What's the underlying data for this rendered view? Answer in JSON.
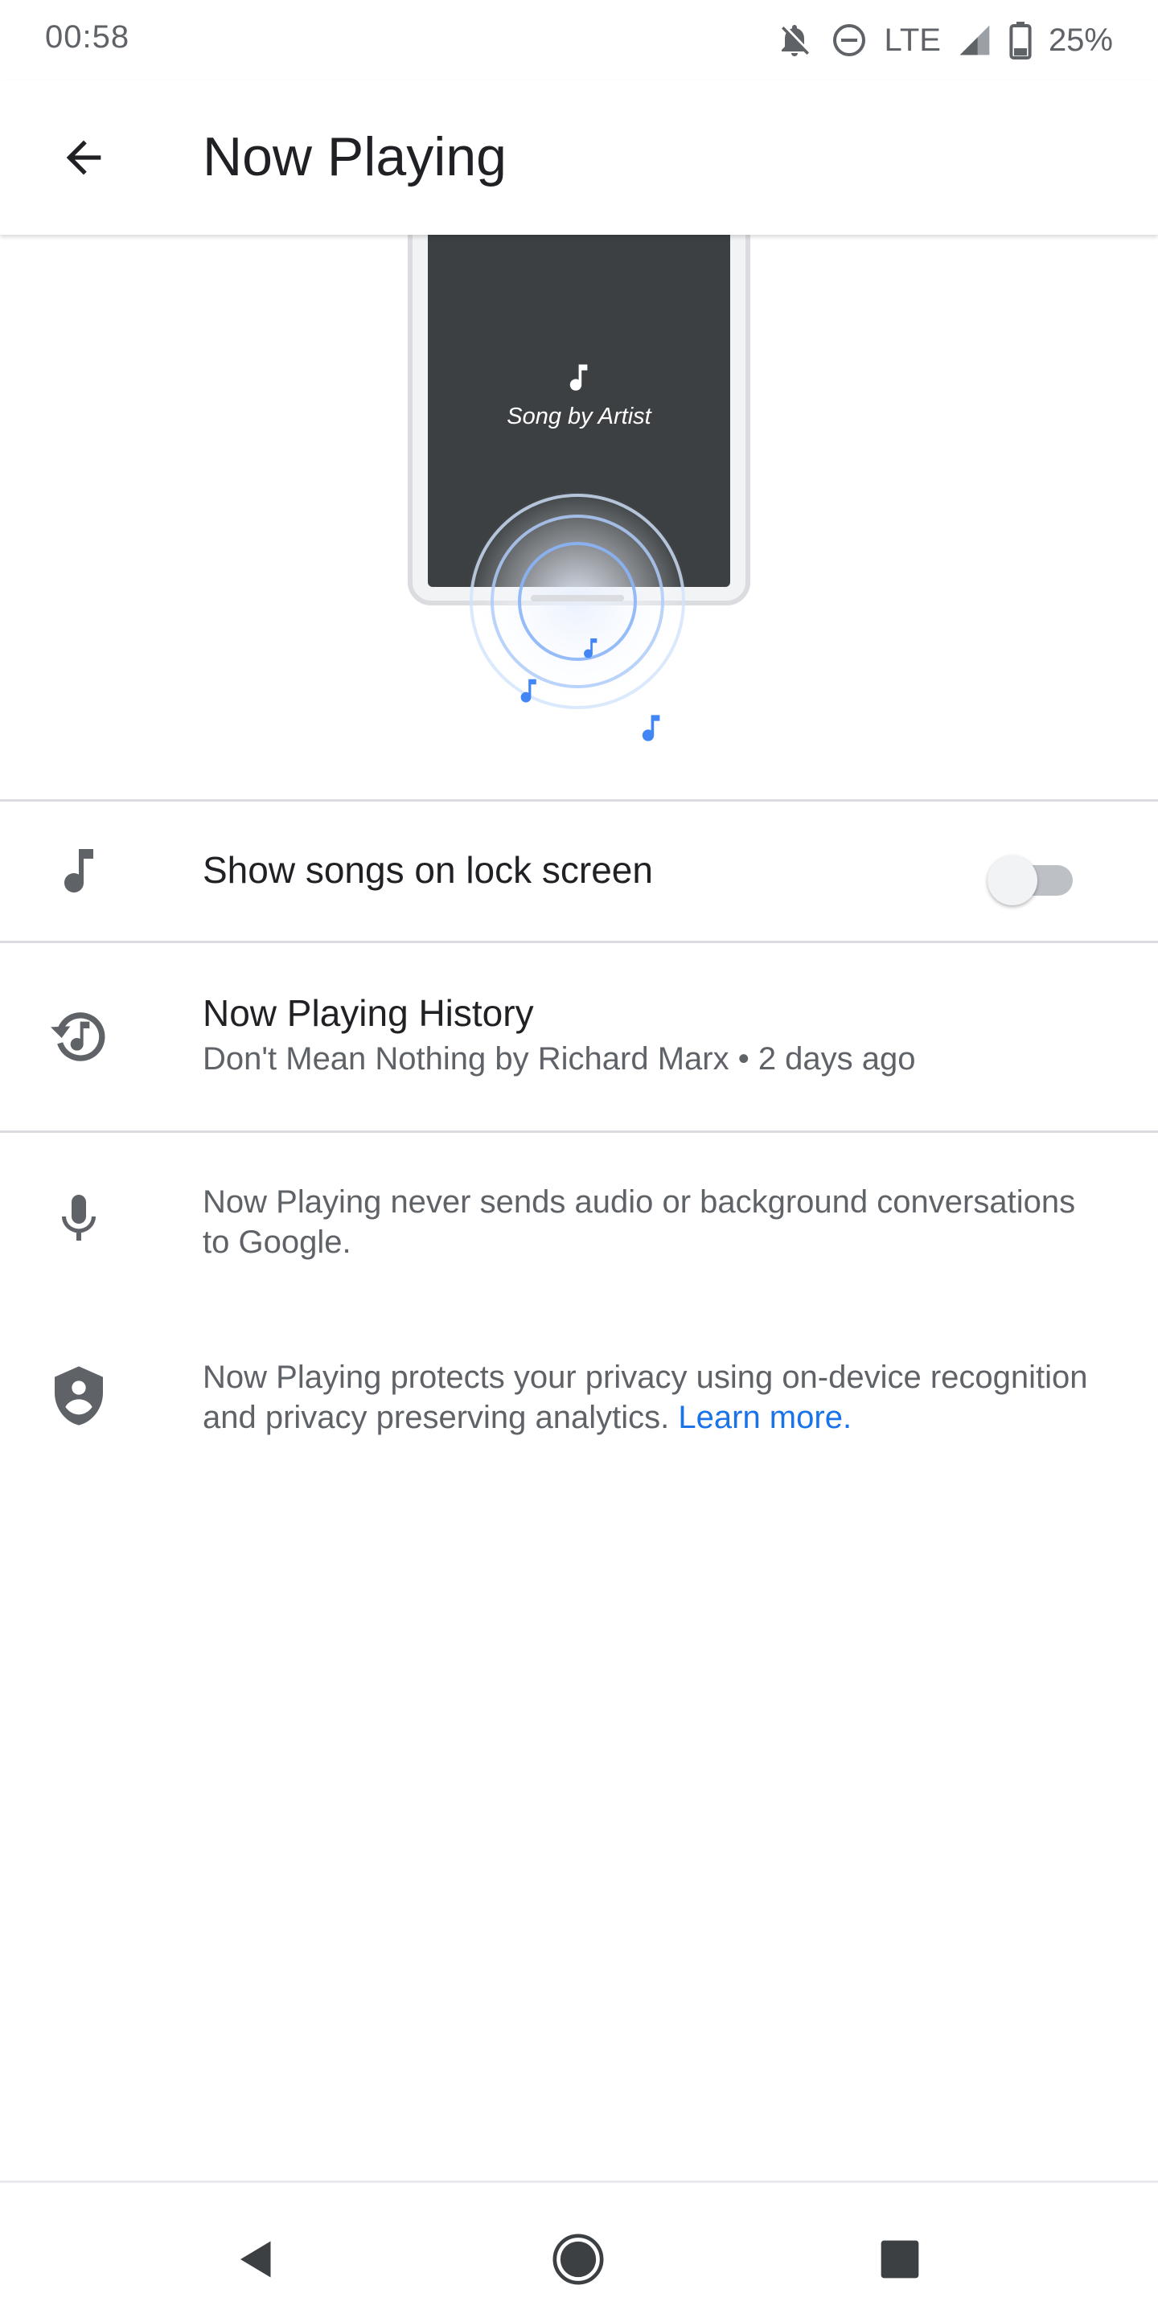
{
  "status_bar": {
    "time": "00:58",
    "network": "LTE",
    "battery": "25%",
    "icons": [
      "notifications-off-icon",
      "do-not-disturb-icon",
      "signal-icon",
      "battery-icon"
    ]
  },
  "app_bar": {
    "title": "Now Playing",
    "back_icon": "arrow-back-icon"
  },
  "illustration": {
    "song_caption": "Song by Artist",
    "phone_screen_color": "#3c4043",
    "ripple_color": "#4285f4"
  },
  "settings": {
    "lock_screen": {
      "icon": "music-note-icon",
      "label": "Show songs on lock screen",
      "toggle_on": false
    },
    "history": {
      "icon": "history-music-icon",
      "title": "Now Playing History",
      "subtitle": "Don't Mean Nothing by Richard Marx • 2 days ago"
    }
  },
  "info": {
    "audio_note": {
      "icon": "microphone-icon",
      "text": "Now Playing never sends audio or background conversations to Google."
    },
    "privacy_note": {
      "icon": "shield-person-icon",
      "text": "Now Playing protects your privacy using on-device recognition and privacy preserving analytics. ",
      "link": "Learn more."
    }
  },
  "nav_bar": {
    "buttons": [
      "back-triangle-icon",
      "home-circle-icon",
      "recents-square-icon"
    ]
  },
  "colors": {
    "accent": "#1a73e8",
    "secondary_text": "#5f6368",
    "primary_text": "#202124"
  }
}
